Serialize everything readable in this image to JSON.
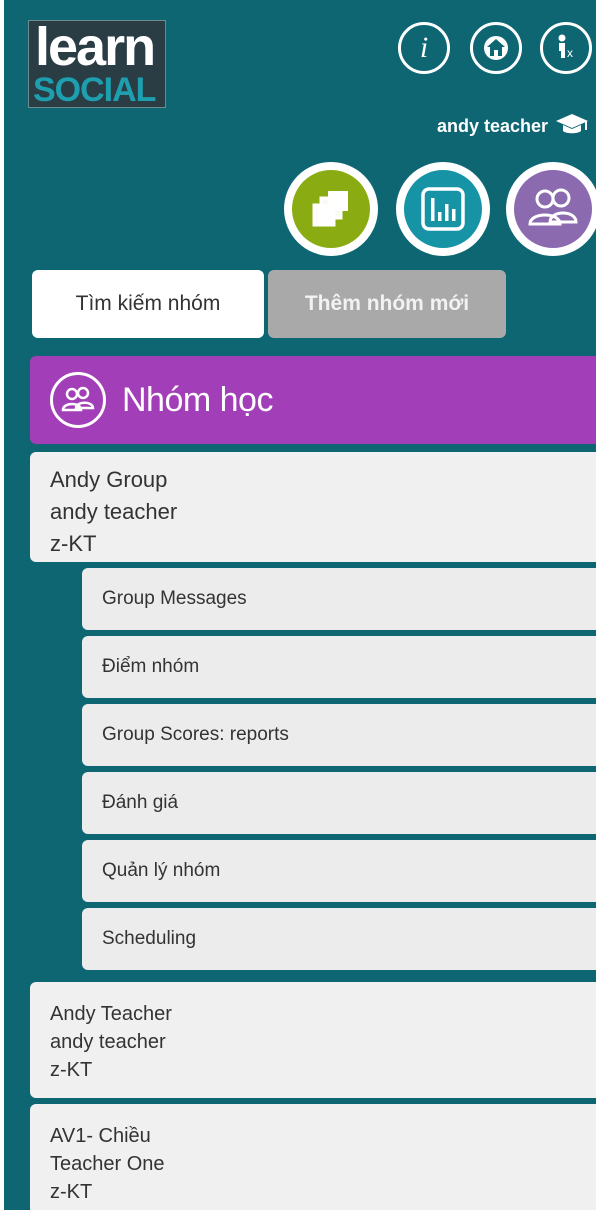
{
  "logo": {
    "line1": "learn",
    "line2": "SOCIAL"
  },
  "header": {
    "username": "andy teacher"
  },
  "icons": {
    "info": "info-icon",
    "home": "home-icon",
    "accessibility": "accessibility-icon",
    "user_badge": "graduation-cap-icon"
  },
  "nav_circles": [
    {
      "name": "courses-icon",
      "color": "#8aac12"
    },
    {
      "name": "reports-icon",
      "color": "#1793a6"
    },
    {
      "name": "groups-icon",
      "color": "#8b6ab0"
    }
  ],
  "tabs": {
    "search": "Tìm kiếm nhóm",
    "new": "Thêm nhóm mới"
  },
  "section": {
    "title": "Nhóm học",
    "color": "#a23eb7"
  },
  "groups": [
    {
      "name": "Andy Group",
      "teacher": "andy teacher",
      "code": "z-KT"
    },
    {
      "name": "Andy Teacher",
      "teacher": "andy teacher",
      "code": "z-KT"
    },
    {
      "name": "AV1- Chiều",
      "teacher": "Teacher One",
      "code": "z-KT"
    }
  ],
  "group_menu": [
    "Group Messages",
    "Điểm nhóm",
    "Group Scores: reports",
    "Đánh giá",
    "Quản lý nhóm",
    "Scheduling"
  ],
  "colors": {
    "background": "#0e6673",
    "card": "#f0f0f0"
  }
}
